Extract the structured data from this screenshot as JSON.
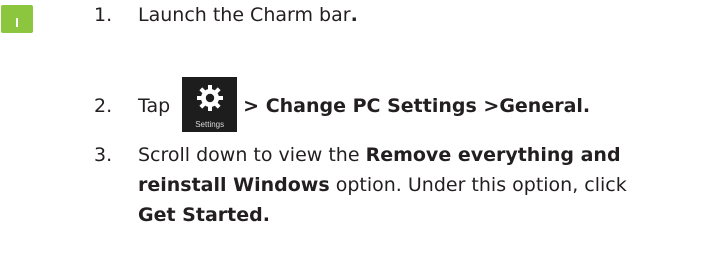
{
  "steps": [
    {
      "number": "1.",
      "text": "Launch the Charm bar",
      "bold_suffix": "."
    },
    {
      "number": "2.",
      "before": "Tap",
      "icon": "settings-gear-icon",
      "icon_caption": "Settings",
      "after_bold": "> Change PC Settings >General."
    },
    {
      "number": "3.",
      "text_a": "Scroll down to view the ",
      "bold_a": "Remove everything and",
      "bold_b": "reinstall Windows",
      "text_b": " option. Under this option, click",
      "bold_c": "Get Started."
    }
  ],
  "colors": {
    "touch_icon": "#8cc63f",
    "tile_background": "#1d1d1d",
    "text": "#231f20"
  },
  "side_icon": "touch-gesture-icon"
}
